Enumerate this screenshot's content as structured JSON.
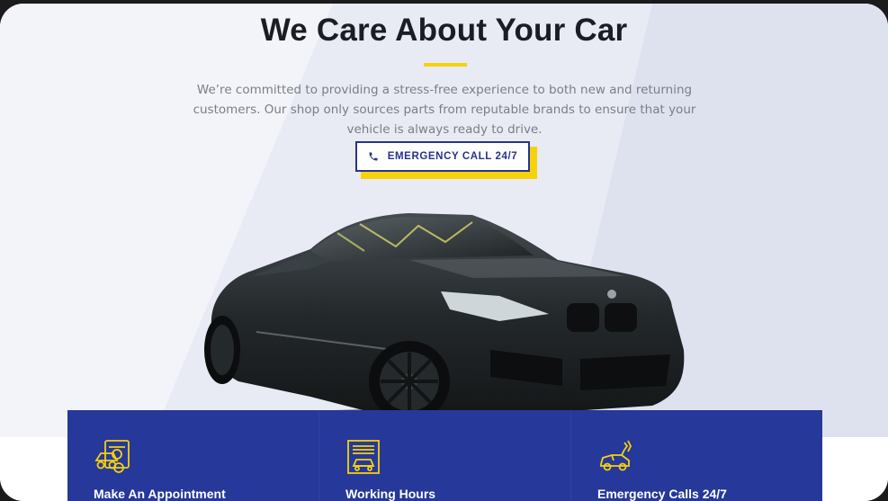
{
  "hero": {
    "title": "We Care About Your Car",
    "description": "We’re committed to providing a stress-free experience to both new and returning customers. Our shop only sources parts from reputable brands to ensure that your vehicle is always ready to drive.",
    "cta_label": "EMERGENCY CALL 24/7"
  },
  "features": [
    {
      "icon": "appointment-icon",
      "label": "Make An Appointment"
    },
    {
      "icon": "garage-icon",
      "label": "Working Hours"
    },
    {
      "icon": "tow-truck-icon",
      "label": "Emergency Calls 24/7"
    }
  ],
  "colors": {
    "accent_yellow": "#f6d20b",
    "brand_blue": "#26389a",
    "button_border": "#27338c",
    "title_text": "#1c1c24"
  }
}
